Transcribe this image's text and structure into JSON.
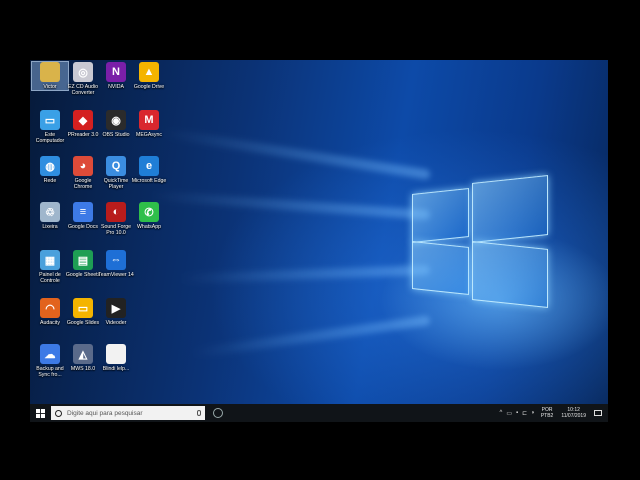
{
  "desktop": {
    "icons": [
      {
        "label": "Victor",
        "glyph": "",
        "color": "#d9b34a",
        "selected": true
      },
      {
        "label": "EZ CD Audio Converter",
        "glyph": "◎",
        "color": "#c9c9d2"
      },
      {
        "label": "NVIDA",
        "glyph": "N",
        "color": "#7a1fa8"
      },
      {
        "label": "Google Drive",
        "glyph": "▲",
        "color": "#f4b400"
      },
      {
        "label": "Este Computador",
        "glyph": "▭",
        "color": "#3aa0e6"
      },
      {
        "label": "PRreader 3.0",
        "glyph": "◆",
        "color": "#d42020"
      },
      {
        "label": "OBS Studio",
        "glyph": "◉",
        "color": "#2b2b2b"
      },
      {
        "label": "MEGAsync",
        "glyph": "M",
        "color": "#d9272e"
      },
      {
        "label": "Rede",
        "glyph": "◍",
        "color": "#2f8ee0"
      },
      {
        "label": "Google Chrome",
        "glyph": "◕",
        "color": "#dd4b39"
      },
      {
        "label": "QuickTime Player",
        "glyph": "Q",
        "color": "#3b8de0"
      },
      {
        "label": "Microsoft Edge",
        "glyph": "e",
        "color": "#1f7ed6"
      },
      {
        "label": "Lixeira",
        "glyph": "♲",
        "color": "#9fb6cc"
      },
      {
        "label": "Google Docs",
        "glyph": "≡",
        "color": "#3d7ae6"
      },
      {
        "label": "Sound Forge Pro 10.0",
        "glyph": "◐",
        "color": "#b81c1c"
      },
      {
        "label": "WhatsApp",
        "glyph": "✆",
        "color": "#2fbf4a"
      },
      {
        "label": "Painel de Controle",
        "glyph": "▦",
        "color": "#4aa0dc"
      },
      {
        "label": "Google Sheets",
        "glyph": "▤",
        "color": "#1e9e54"
      },
      {
        "label": "TeamViewer 14",
        "glyph": "⇔",
        "color": "#1e6fd6"
      },
      {
        "label": "",
        "glyph": "",
        "color": "rgba(0,0,0,0)"
      },
      {
        "label": "Audacity",
        "glyph": "◠",
        "color": "#e2631d"
      },
      {
        "label": "Google Slides",
        "glyph": "▭",
        "color": "#f4b400"
      },
      {
        "label": "Videoder",
        "glyph": "▶",
        "color": "#222"
      },
      {
        "label": "",
        "glyph": "",
        "color": "rgba(0,0,0,0)"
      },
      {
        "label": "Backup and Sync fro...",
        "glyph": "☁",
        "color": "#3d7ae6"
      },
      {
        "label": "MWS 18.0",
        "glyph": "◭",
        "color": "#5a6a8a"
      },
      {
        "label": "Blindi lelp...",
        "glyph": "",
        "color": "#f2f2f2"
      }
    ]
  },
  "taskbar": {
    "search_placeholder": "Digite aqui para pesquisar",
    "tray_icons": [
      "^",
      "▭",
      "▪",
      "⊏",
      "◗"
    ],
    "language_top": "POR",
    "language_bottom": "PTB2",
    "time": "10:12",
    "date": "11/07/2019"
  }
}
